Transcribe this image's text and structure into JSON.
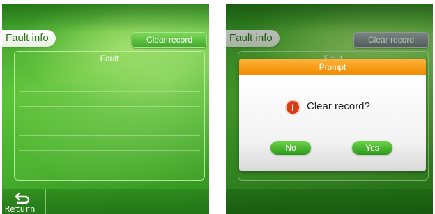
{
  "left_screen": {
    "title": "Fault info",
    "clear_button": "Clear record",
    "panel_header": "Fault",
    "return_label": "Return"
  },
  "right_screen": {
    "title": "Fault info",
    "clear_button": "Clear record",
    "panel_header": "Fault",
    "dialog": {
      "title": "Prompt",
      "message": "Clear record?",
      "no_label": "No",
      "yes_label": "Yes",
      "icon": "warning-icon"
    }
  },
  "colors": {
    "background_green": "#48b22e",
    "dialog_header_orange": "#f08a00",
    "warning_red": "#d83a1a",
    "disabled_gray": "#6f777c"
  }
}
